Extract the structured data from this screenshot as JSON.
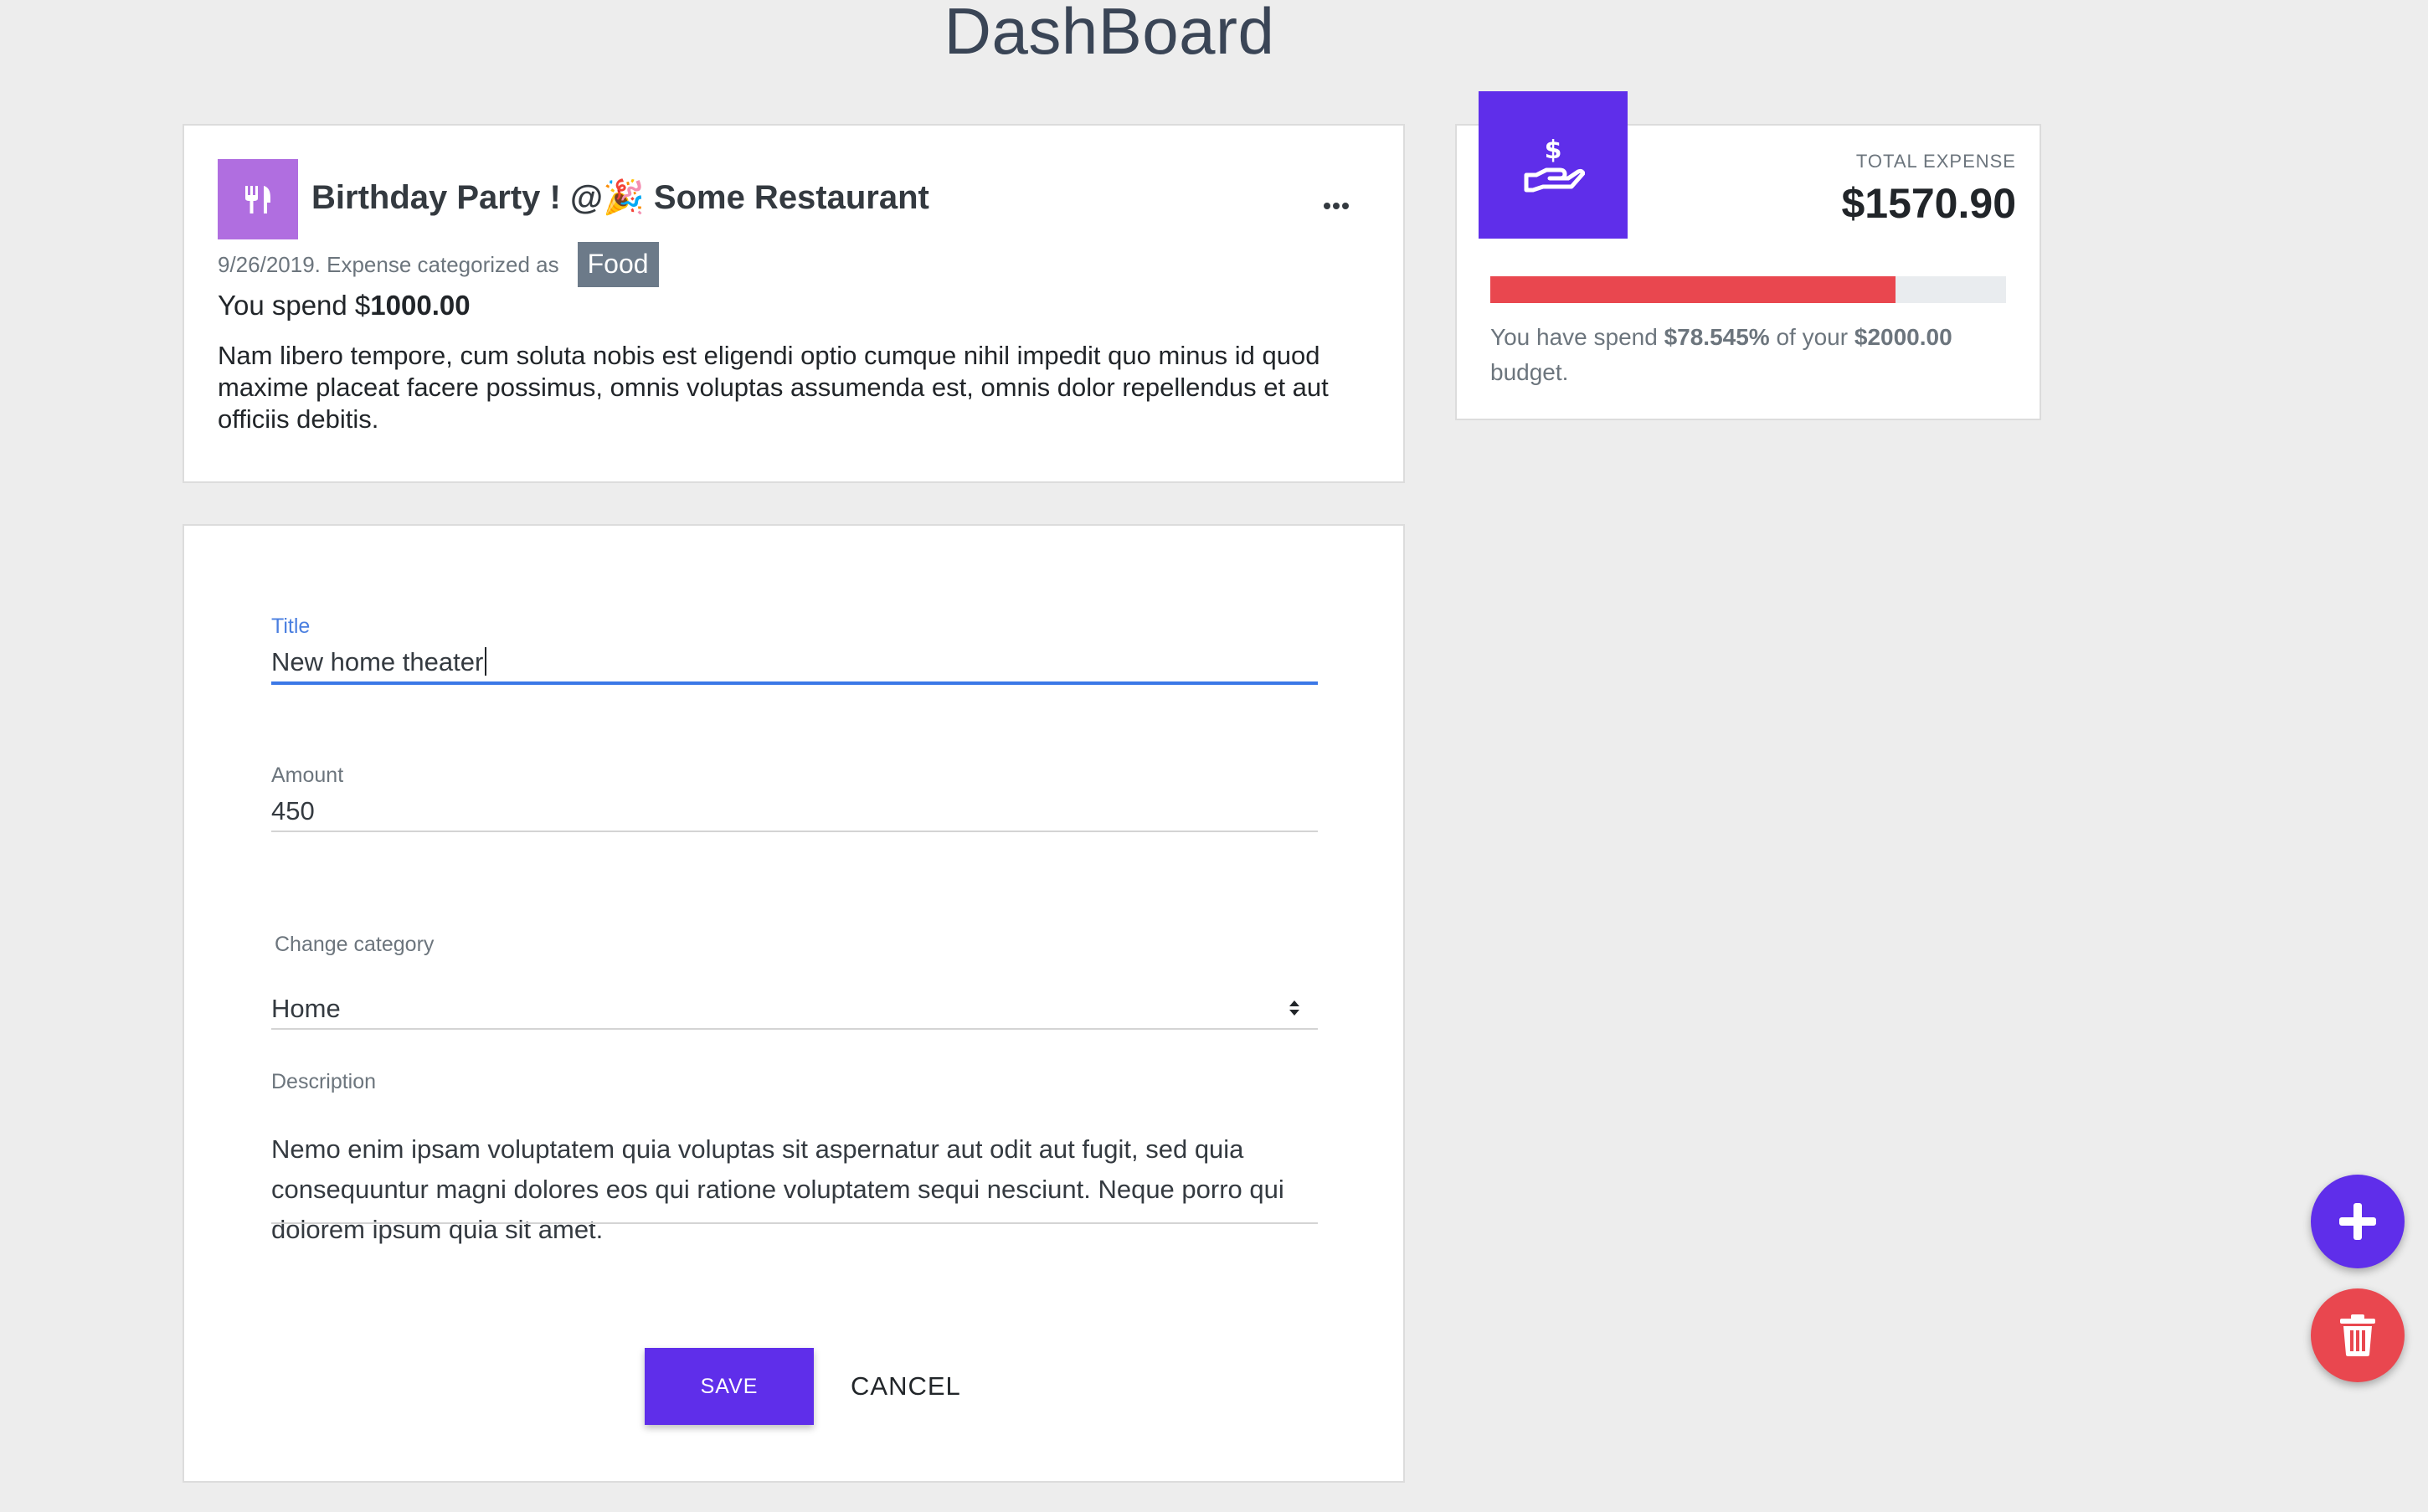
{
  "header": {
    "title": "DashBoard"
  },
  "expense": {
    "title": "Birthday Party ! @🎉 Some Restaurant",
    "meta": "9/26/2019. Expense categorized as",
    "category": "Food",
    "spend_prefix": "You spend $",
    "spend_amount": "1000.00",
    "description": "Nam libero tempore, cum soluta nobis est eligendi optio cumque nihil impedit quo minus id quod maxime placeat facere possimus, omnis voluptas assumenda est, omnis dolor repellendus et aut officiis debitis.",
    "category_icon": "utensils-icon",
    "category_color": "#b06ee0",
    "menu_icon": "ellipsis-icon"
  },
  "summary": {
    "label": "TOTAL EXPENSE",
    "total": "$1570.90",
    "progress_fraction": 0.78545,
    "budget_prefix": "You have spend ",
    "percent": "$78.545%",
    "budget_mid": " of your ",
    "budget": "$2000.00",
    "budget_suffix": " budget.",
    "icon": "hand-dollar-icon",
    "accent_color": "#5f2eea",
    "progress_color": "#e9474f"
  },
  "form": {
    "title_label": "Title",
    "title_value": "New home theater",
    "amount_label": "Amount",
    "amount_value": "450",
    "category_label": "Change category",
    "category_value": "Home",
    "description_label": "Description",
    "description_value": "Nemo enim ipsam voluptatem quia voluptas sit aspernatur aut odit aut fugit, sed quia consequuntur magni dolores eos qui ratione voluptatem sequi nesciunt. Neque porro qui dolorem ipsum quia sit amet.",
    "save_label": "SAVE",
    "cancel_label": "CANCEL"
  },
  "fabs": {
    "add_icon": "plus-icon",
    "delete_icon": "trash-icon",
    "add_color": "#5f2eea",
    "delete_color": "#e9474f"
  }
}
